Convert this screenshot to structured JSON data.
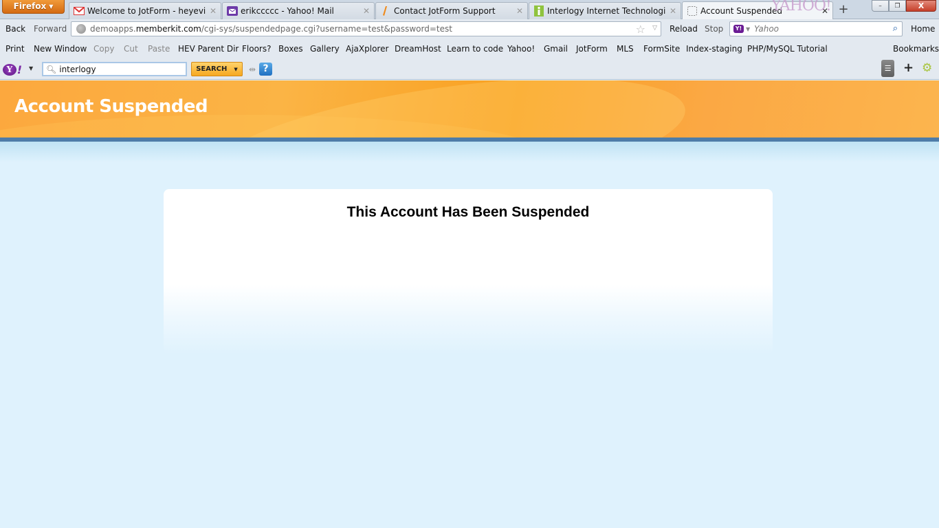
{
  "browser": {
    "menu_button": "Firefox",
    "tabs": [
      {
        "title": "Welcome to JotForm - heyeview...",
        "icon": "gmail-icon",
        "active": false
      },
      {
        "title": "erikccccc - Yahoo! Mail",
        "icon": "yahoo-mail-icon",
        "active": false
      },
      {
        "title": "Contact JotForm Support",
        "icon": "jotform-icon",
        "active": false
      },
      {
        "title": "Interlogy Internet Technologies",
        "icon": "interlogy-icon",
        "active": false
      },
      {
        "title": "Account Suspended",
        "icon": "blank-page-icon",
        "active": true
      }
    ],
    "tab_watermark": "YAHOO!",
    "new_tab": "+",
    "window_controls": {
      "minimize": "–",
      "restore": "❐",
      "close": "X"
    }
  },
  "navbar": {
    "back": "Back",
    "forward": "Forward",
    "url_prefix": "demoapps.",
    "url_domain": "memberkit.com",
    "url_path": "/cgi-sys/suspendedpage.cgi?username=test&password=test",
    "reload": "Reload",
    "stop": "Stop",
    "search_engine_badge": "Y!",
    "search_placeholder": "Yahoo",
    "home": "Home"
  },
  "bookmarks": {
    "items": [
      "Print",
      "New Window",
      "Copy",
      "Cut",
      "Paste",
      "HEV Parent Dir",
      "Floors?",
      "Boxes",
      "Gallery",
      "AjaXplorer",
      "DreamHost",
      "Learn to code",
      "Yahoo!",
      "Gmail",
      "JotForm",
      "MLS",
      "FormSite",
      "Index-staging",
      "PHP/MySQL Tutorial"
    ],
    "disabled": [
      "Copy",
      "Cut",
      "Paste"
    ],
    "menu": "Bookmarks"
  },
  "yahoo_toolbar": {
    "logo": "Y!",
    "search_value": "interlogy",
    "search_button": "SEARCH",
    "help": "?"
  },
  "page": {
    "header_title": "Account Suspended",
    "message": "This Account Has Been Suspended",
    "colors": {
      "header_orange": "#fbad3c",
      "header_rule": "#4e7ca8",
      "background": "#dff2fd"
    }
  }
}
